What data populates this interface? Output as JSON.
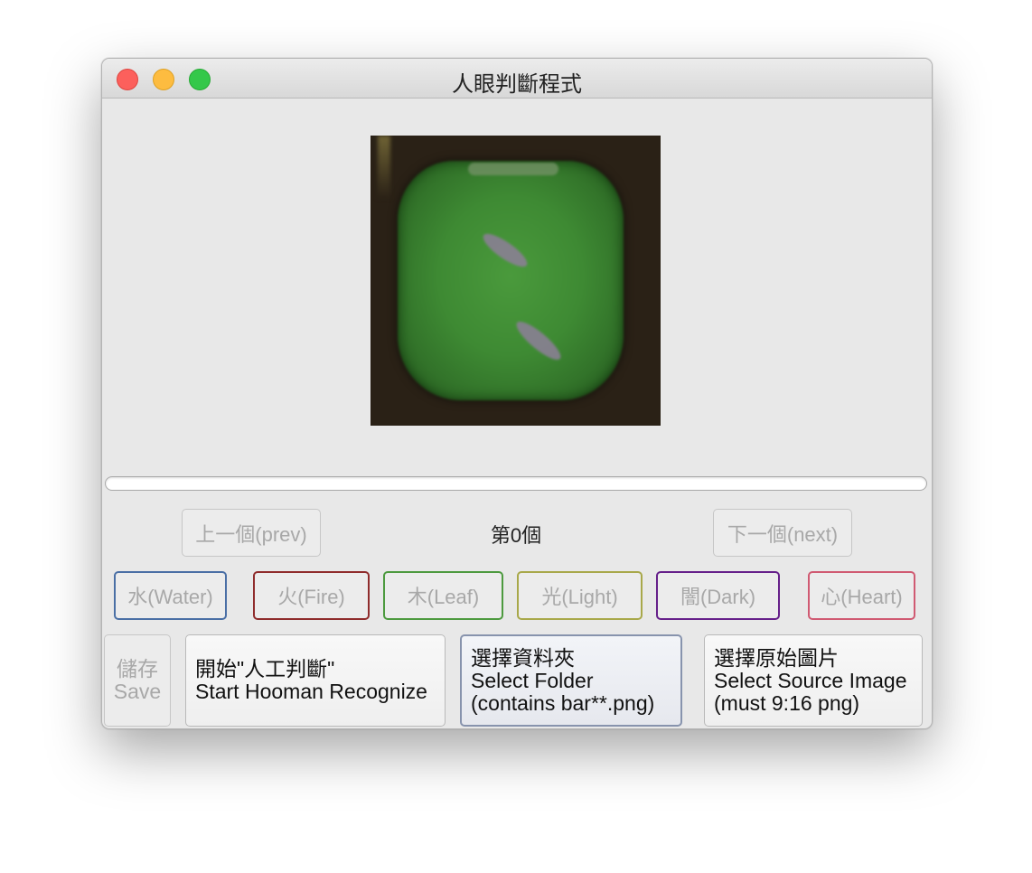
{
  "window": {
    "title": "人眼判斷程式"
  },
  "progress": {
    "value": 0
  },
  "navigation": {
    "prev_label": "上一個(prev)",
    "next_label": "下一個(next)",
    "counter": "第0個"
  },
  "attributes": [
    {
      "label": "水(Water)",
      "color": "#4a6fa5"
    },
    {
      "label": "火(Fire)",
      "color": "#8f2c2c"
    },
    {
      "label": "木(Leaf)",
      "color": "#4d9a3f"
    },
    {
      "label": "光(Light)",
      "color": "#a8a84a"
    },
    {
      "label": "闇(Dark)",
      "color": "#66208a"
    },
    {
      "label": "心(Heart)",
      "color": "#d05a72"
    }
  ],
  "actions": {
    "save": {
      "line1": "儲存",
      "line2": "Save"
    },
    "start": {
      "line1": "開始\"人工判斷\"",
      "line2": "Start Hooman Recognize"
    },
    "select_folder": {
      "line1": "選擇資料夾",
      "line2": "Select Folder",
      "line3": "(contains bar**.png)"
    },
    "select_source": {
      "line1": "選擇原始圖片",
      "line2": "Select Source Image",
      "line3": "(must 9:16 png)"
    }
  }
}
